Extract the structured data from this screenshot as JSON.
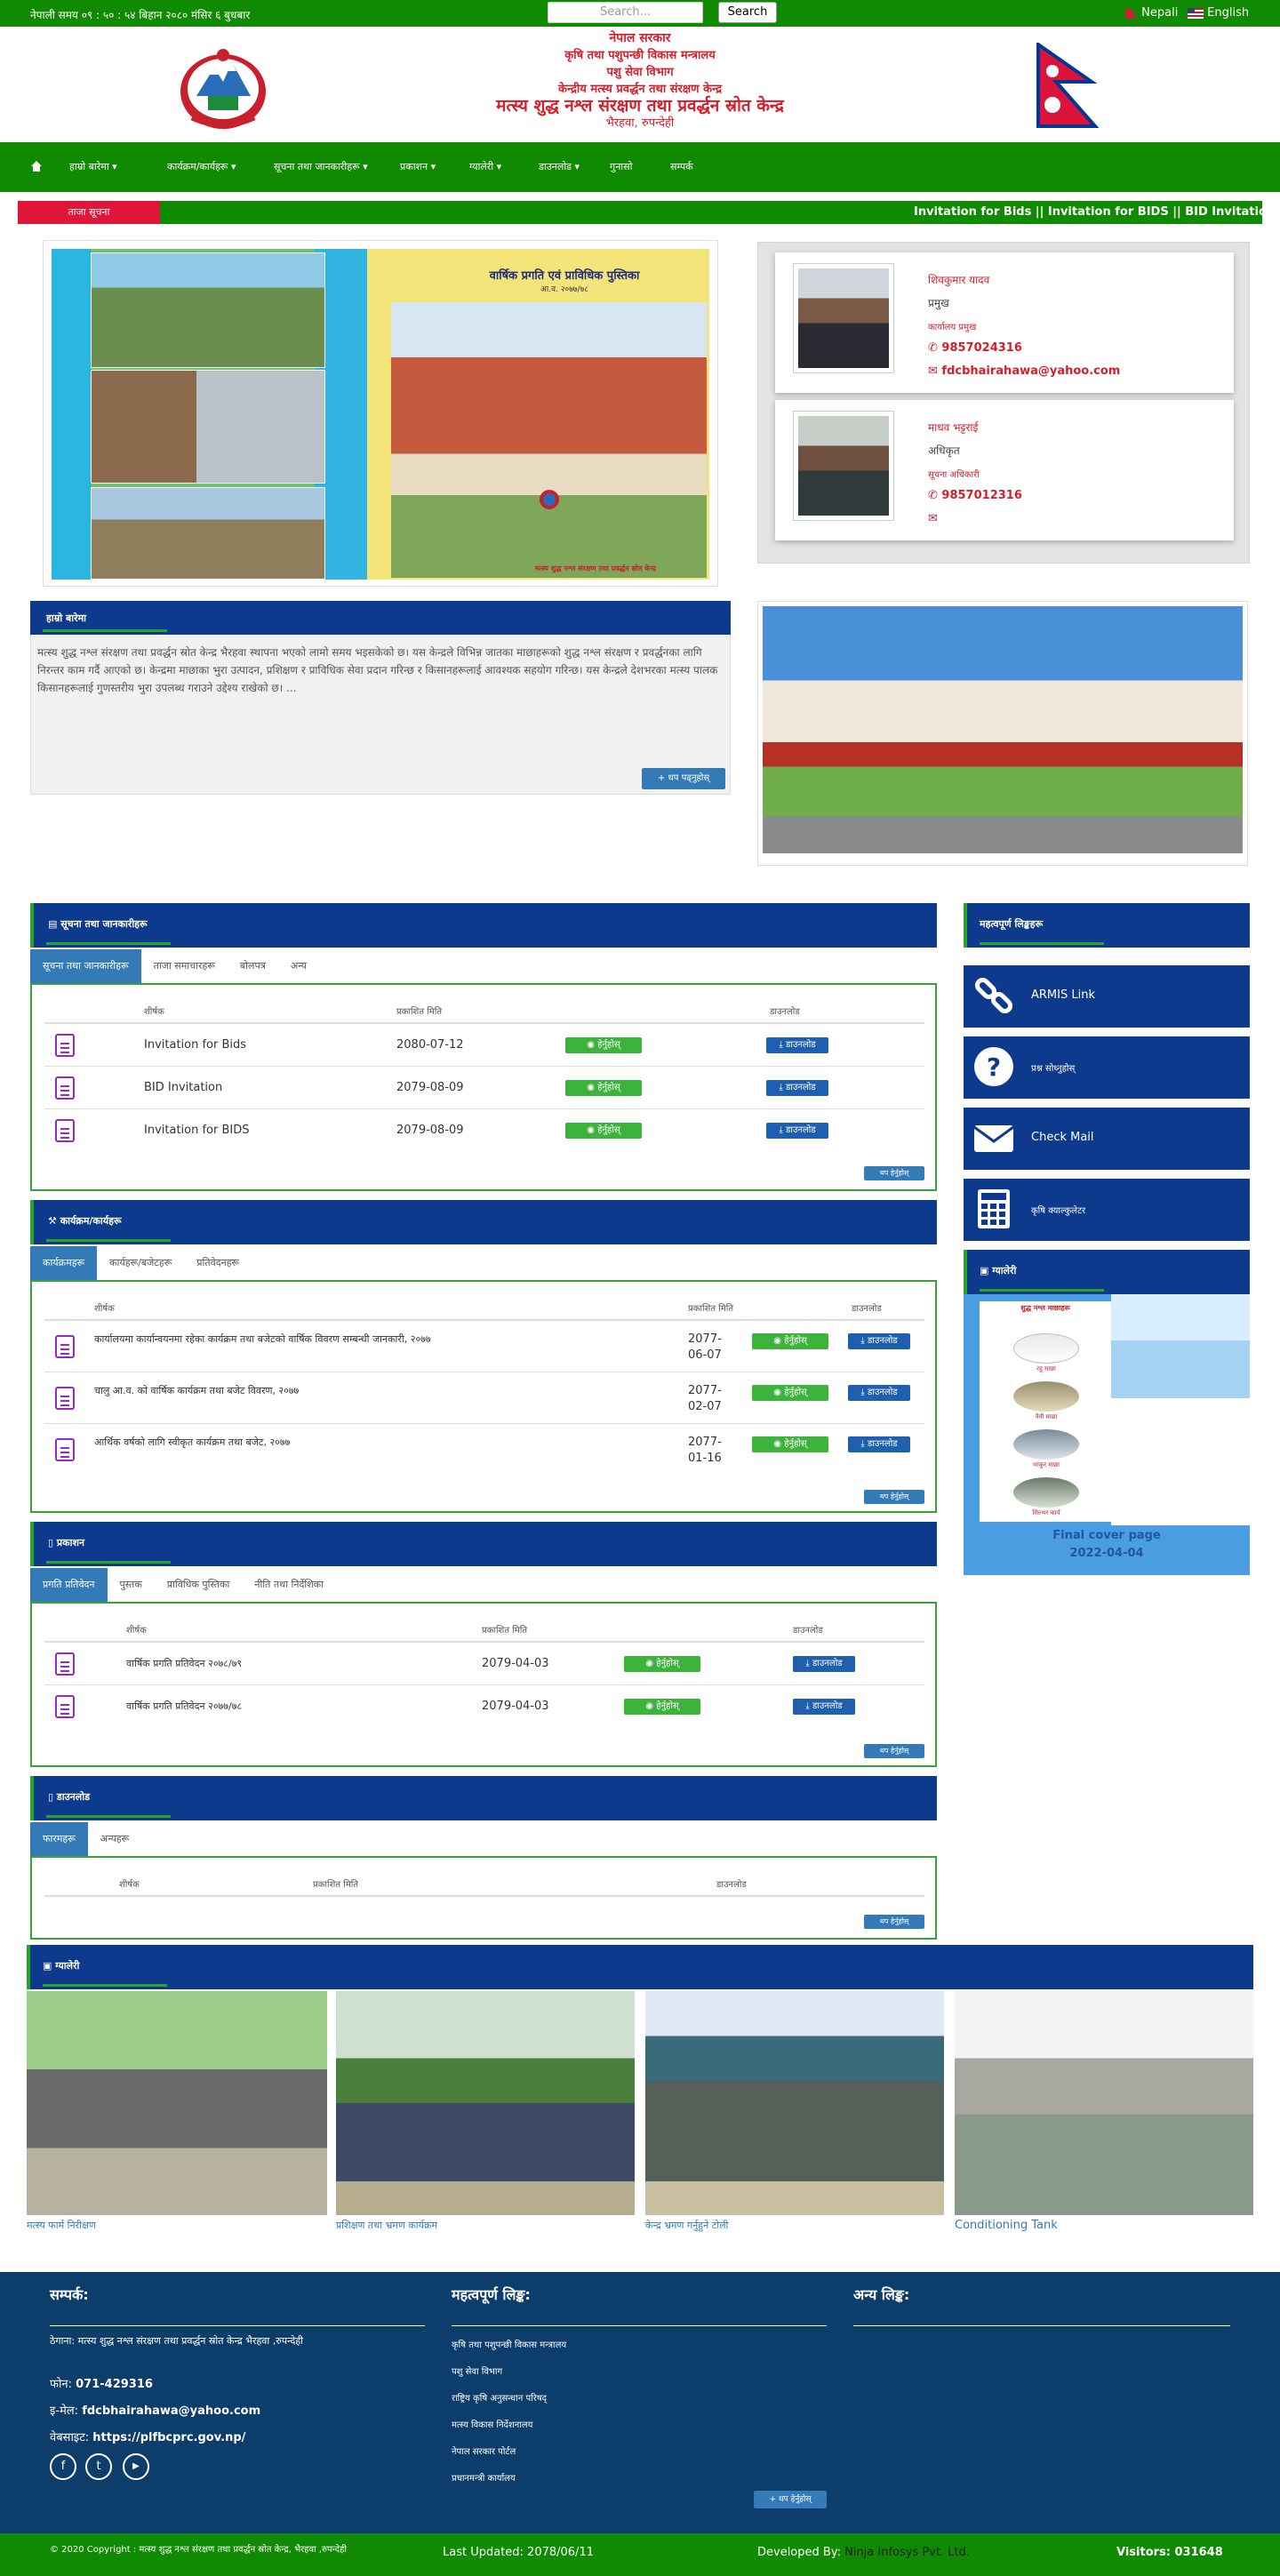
{
  "topbar": {
    "time": "नेपाली समय ०९ : ५० : ५४ बिहान  २०८० मंसिर ६ बुधबार",
    "search_placeholder": "Search...",
    "search_button": "Search",
    "lang_np": "Nepali",
    "lang_en": "English"
  },
  "header": {
    "line1": "नेपाल सरकार",
    "line2": "कृषि तथा पशुपन्छी विकास मन्त्रालय",
    "line3": "पशु सेवा विभाग",
    "line4": "केन्द्रीय मत्स्य प्रवर्द्धन तथा संरक्षण केन्द्र",
    "line5": "मत्स्य शुद्ध नश्ल संरक्षण तथा प्रवर्द्धन स्रोत केन्द्र",
    "line6": "भैरहवा, रुपन्देही"
  },
  "nav": {
    "home_icon": "home-icon",
    "items": [
      "हाम्रो बारेमा",
      "कार्यक्रम/कार्यहरू",
      "सूचना तथा जानकारीहरू",
      "प्रकाशन",
      "ग्यालेरी",
      "डाउनलोड",
      "गुनासो",
      "सम्पर्क"
    ]
  },
  "ticker": {
    "label": "ताजा सूचना",
    "text": "Invitation for Bids    || Invitation for BIDS    || BID Invitation"
  },
  "banner": {
    "title": "वार्षिक प्रगति एवं प्राविधिक पुस्तिका",
    "subtitle": "आ.व. २०७७/७८",
    "footer": "मत्स्य शुद्ध नश्ल संरक्षण तथा प्रवर्द्धन स्रोत केन्द्र"
  },
  "contacts": [
    {
      "name": "शिवकुमार यादव",
      "role": "प्रमुख",
      "sub": "कार्यालय प्रमुख",
      "phone": "9857024316",
      "email": "fdcbhairahawa@yahoo.com"
    },
    {
      "name": "माधव भट्टराई",
      "role": "अधिकृत",
      "sub": "सूचना अधिकारी",
      "phone": "9857012316",
      "email": ""
    }
  ],
  "intro": {
    "heading": "हाम्रो बारेमा",
    "text": "मत्स्य शुद्ध नश्ल संरक्षण तथा प्रवर्द्धन स्रोत केन्द्र भैरहवा स्थापना भएको लामो समय भइसकेको छ। यस केन्द्रले विभिन्न जातका माछाहरूको शुद्ध नश्ल संरक्षण र प्रवर्द्धनका लागि निरन्तर काम गर्दै आएको छ। केन्द्रमा माछाका भुरा उत्पादन, प्रशिक्षण र प्राविधिक सेवा प्रदान गरिन्छ र किसानहरूलाई आवश्यक सहयोग गरिन्छ। यस केन्द्रले देशभरका मत्स्य पालक किसानहरूलाई गुणस्तरीय भुरा उपलब्ध गराउने उद्देश्य राखेको छ। ...",
    "more": "थप पढ्नुहोस्"
  },
  "notices": {
    "heading": "सूचना तथा जानकारीहरू",
    "tabs": [
      "सूचना तथा जानकारीहरू",
      "ताजा समाचारहरू",
      "बोलपत्र",
      "अन्य"
    ],
    "cols": [
      "शीर्षक",
      "प्रकाशित मिति",
      "डाउनलोड"
    ],
    "rows": [
      {
        "title": "Invitation for Bids",
        "date": "2080-07-12"
      },
      {
        "title": "BID Invitation",
        "date": "2079-08-09"
      },
      {
        "title": "Invitation for BIDS",
        "date": "2079-08-09"
      }
    ],
    "view": "हेर्नुहोस्",
    "download": "डाउनलोड",
    "more": "थप हेर्नुहोस्"
  },
  "programs": {
    "heading": "कार्यक्रम/कार्यहरू",
    "tabs": [
      "कार्यक्रमहरू",
      "कार्यहरू/बजेटहरू",
      "प्रतिवेदनहरू"
    ],
    "cols": [
      "शीर्षक",
      "प्रकाशित मिति",
      "डाउनलोड"
    ],
    "rows": [
      {
        "title": "कार्यालयमा कार्यान्वयनमा रहेका कार्यक्रम तथा बजेटको वार्षिक विवरण सम्बन्धी जानकारी, २०७७",
        "date": "2077-06-07"
      },
      {
        "title": "चालु आ.व. को वार्षिक कार्यक्रम तथा बजेट विवरण, २०७७",
        "date": "2077-02-07"
      },
      {
        "title": "आर्थिक वर्षको लागि स्वीकृत कार्यक्रम तथा बजेट, २०७७",
        "date": "2077-01-16"
      }
    ],
    "view": "हेर्नुहोस्",
    "download": "डाउनलोड",
    "more": "थप हेर्नुहोस्"
  },
  "publications": {
    "heading": "प्रकाशन",
    "tabs": [
      "प्रगति प्रतिवेदन",
      "पुस्तक",
      "प्राविधिक पुस्तिका",
      "नीति तथा निर्देशिका"
    ],
    "cols": [
      "शीर्षक",
      "प्रकाशित मिति",
      "डाउनलोड"
    ],
    "rows": [
      {
        "title": "वार्षिक प्रगति प्रतिवेदन २०७८/७९",
        "date": "2079-04-03"
      },
      {
        "title": "वार्षिक प्रगति प्रतिवेदन २०७७/७८",
        "date": "2079-04-03"
      }
    ],
    "view": "हेर्नुहोस्",
    "download": "डाउनलोड",
    "more": "थप हेर्नुहोस्"
  },
  "downloads": {
    "heading": "डाउनलोड",
    "tabs": [
      "फारमहरू",
      "अन्यहरू"
    ],
    "cols": [
      "शीर्षक",
      "प्रकाशित मिति",
      "डाउनलोड"
    ],
    "more": "थप हेर्नुहोस्"
  },
  "sidebar": {
    "heading": "महत्वपूर्ण लिङ्कहरू",
    "links": [
      {
        "label": "ARMIS Link",
        "icon": "link-icon"
      },
      {
        "label": "प्रश्न सोध्नुहोस्",
        "icon": "question-icon"
      },
      {
        "label": "Check Mail",
        "icon": "mail-icon"
      },
      {
        "label": "कृषि क्याल्कुलेटर",
        "icon": "calculator-icon"
      }
    ],
    "gallery_heading": "ग्यालेरी",
    "cover_title": "Final cover page",
    "cover_date": "2022-04-04",
    "poster_title": "शुद्ध नश्ल माछाहरू",
    "fish": [
      "रहु माछा",
      "नैनी माछा",
      "भाकुर माछा",
      "सिल्भर कार्प"
    ]
  },
  "gallery": {
    "heading": "ग्यालेरी",
    "items": [
      {
        "caption": "मत्स्य फार्म निरीक्षण"
      },
      {
        "caption": "प्रशिक्षण तथा भ्रमण कार्यक्रम"
      },
      {
        "caption": "केन्द्र भ्रमण गर्नुहुने टोली"
      },
      {
        "caption": "Conditioning Tank"
      }
    ]
  },
  "footer": {
    "contact_heading": "सम्पर्क:",
    "links_heading": "महत्वपूर्ण लिङ्क:",
    "other_heading": "अन्य लिङ्क:",
    "address": "ठेगाना: मत्स्य शुद्ध नश्ल संरक्षण तथा प्रवर्द्धन स्रोत केन्द्र भैरहवा ,रुपन्देही",
    "phone_label": "फोन:",
    "phone": "071-429316",
    "email_label": "इ-मेल:",
    "email": "fdcbhairahawa@yahoo.com",
    "web_label": "वेबसाइट:",
    "web": "https://plfbcprc.gov.np/",
    "links": [
      "कृषि तथा पशुपन्छी विकास मन्त्रालय",
      "पशु सेवा विभाग",
      "राष्ट्रिय कृषि अनुसन्धान परिषद्",
      "मत्स्य विकास निर्देशनालय",
      "नेपाल सरकार पोर्टल",
      "प्रधानमन्त्री कार्यालय"
    ],
    "more": "थप हेर्नुहोस्"
  },
  "bottom": {
    "copyright": "© 2020 Copyright : मत्स्य शुद्ध नश्ल संरक्षण तथा प्रवर्द्धन स्रोत केन्द्र, भैरहवा ,रुपन्देही",
    "updated": "Last Updated: 2078/06/11",
    "dev_label": "Developed By:",
    "dev": "Ninja Infosys Pvt. Ltd.",
    "visitors": "Visitors: 031648"
  }
}
